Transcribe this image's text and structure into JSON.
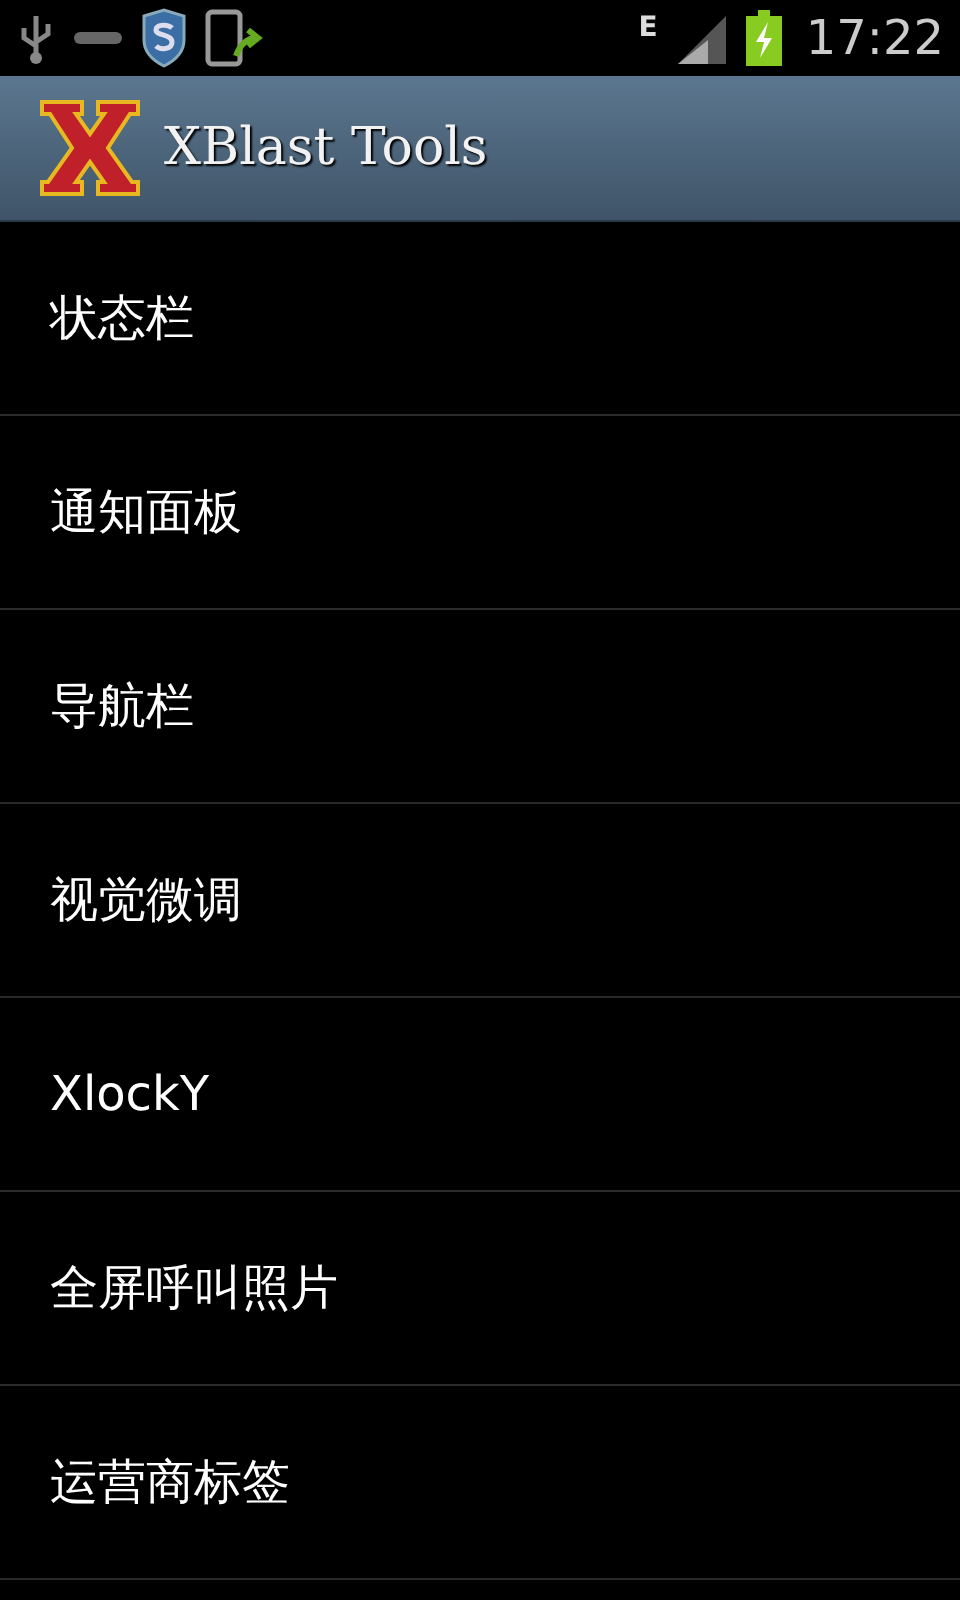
{
  "status_bar": {
    "network": "E",
    "time": "17:22"
  },
  "action_bar": {
    "title": "XBlast Tools"
  },
  "menu_items": [
    {
      "label": "状态栏"
    },
    {
      "label": "通知面板"
    },
    {
      "label": "导航栏"
    },
    {
      "label": "视觉微调"
    },
    {
      "label": "XlockY"
    },
    {
      "label": "全屏呼叫照片"
    },
    {
      "label": "运营商标签"
    }
  ]
}
